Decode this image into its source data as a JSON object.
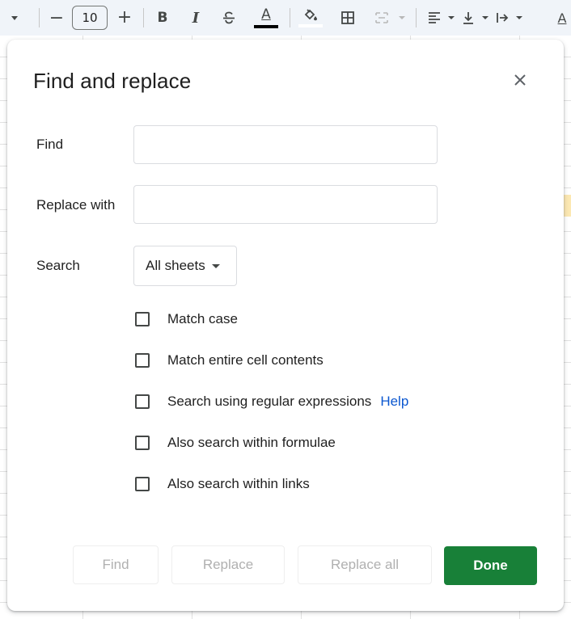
{
  "toolbar": {
    "font_size": "10",
    "items": {
      "decrease": "−",
      "increase": "+",
      "bold": "B",
      "italic": "I",
      "strikethrough": "S",
      "text_color": "A",
      "more": "A"
    },
    "text_color_bar": "#000000"
  },
  "dialog": {
    "title": "Find and replace",
    "fields": {
      "find_label": "Find",
      "find_value": "",
      "replace_label": "Replace with",
      "replace_value": "",
      "search_label": "Search",
      "search_scope": "All sheets"
    },
    "options": [
      {
        "label": "Match case",
        "checked": false
      },
      {
        "label": "Match entire cell contents",
        "checked": false
      },
      {
        "label": "Search using regular expressions",
        "checked": false,
        "link": "Help"
      },
      {
        "label": "Also search within formulae",
        "checked": false
      },
      {
        "label": "Also search within links",
        "checked": false
      }
    ],
    "buttons": {
      "find": "Find",
      "replace": "Replace",
      "replace_all": "Replace all",
      "done": "Done"
    }
  },
  "colors": {
    "primary_button": "#188038",
    "link": "#0b57d0",
    "disabled_text": "#b0b0b0"
  }
}
